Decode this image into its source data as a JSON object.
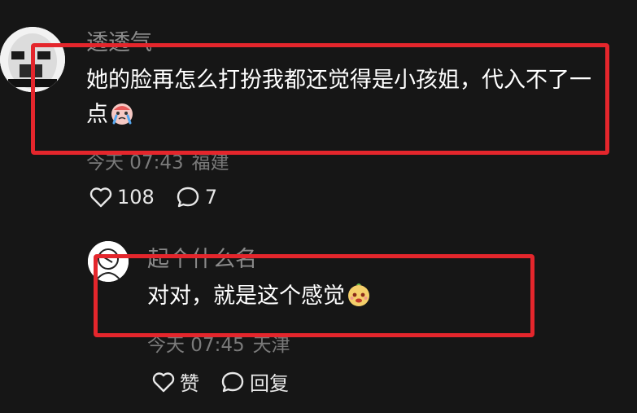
{
  "comment": {
    "avatar_icon": "meme-face-avatar",
    "username": "透透气",
    "text": "她的脸再怎么打扮我都还觉得是小孩姐，代入不了一点",
    "emoji": "crying-face-emoji",
    "time": "今天 07:43",
    "location": "福建",
    "likes": "108",
    "replies": "7"
  },
  "reply": {
    "avatar_icon": "doodle-avatar",
    "username": "起个什么名",
    "text": "对对，就是这个感觉",
    "emoji": "smug-face-emoji",
    "time": "今天 07:45",
    "location": "天津",
    "like_label": "赞",
    "reply_label": "回复"
  },
  "colors": {
    "background": "#161616",
    "highlight": "#e4262c",
    "username": "#8a8a8a",
    "meta": "#7a7a7a"
  }
}
